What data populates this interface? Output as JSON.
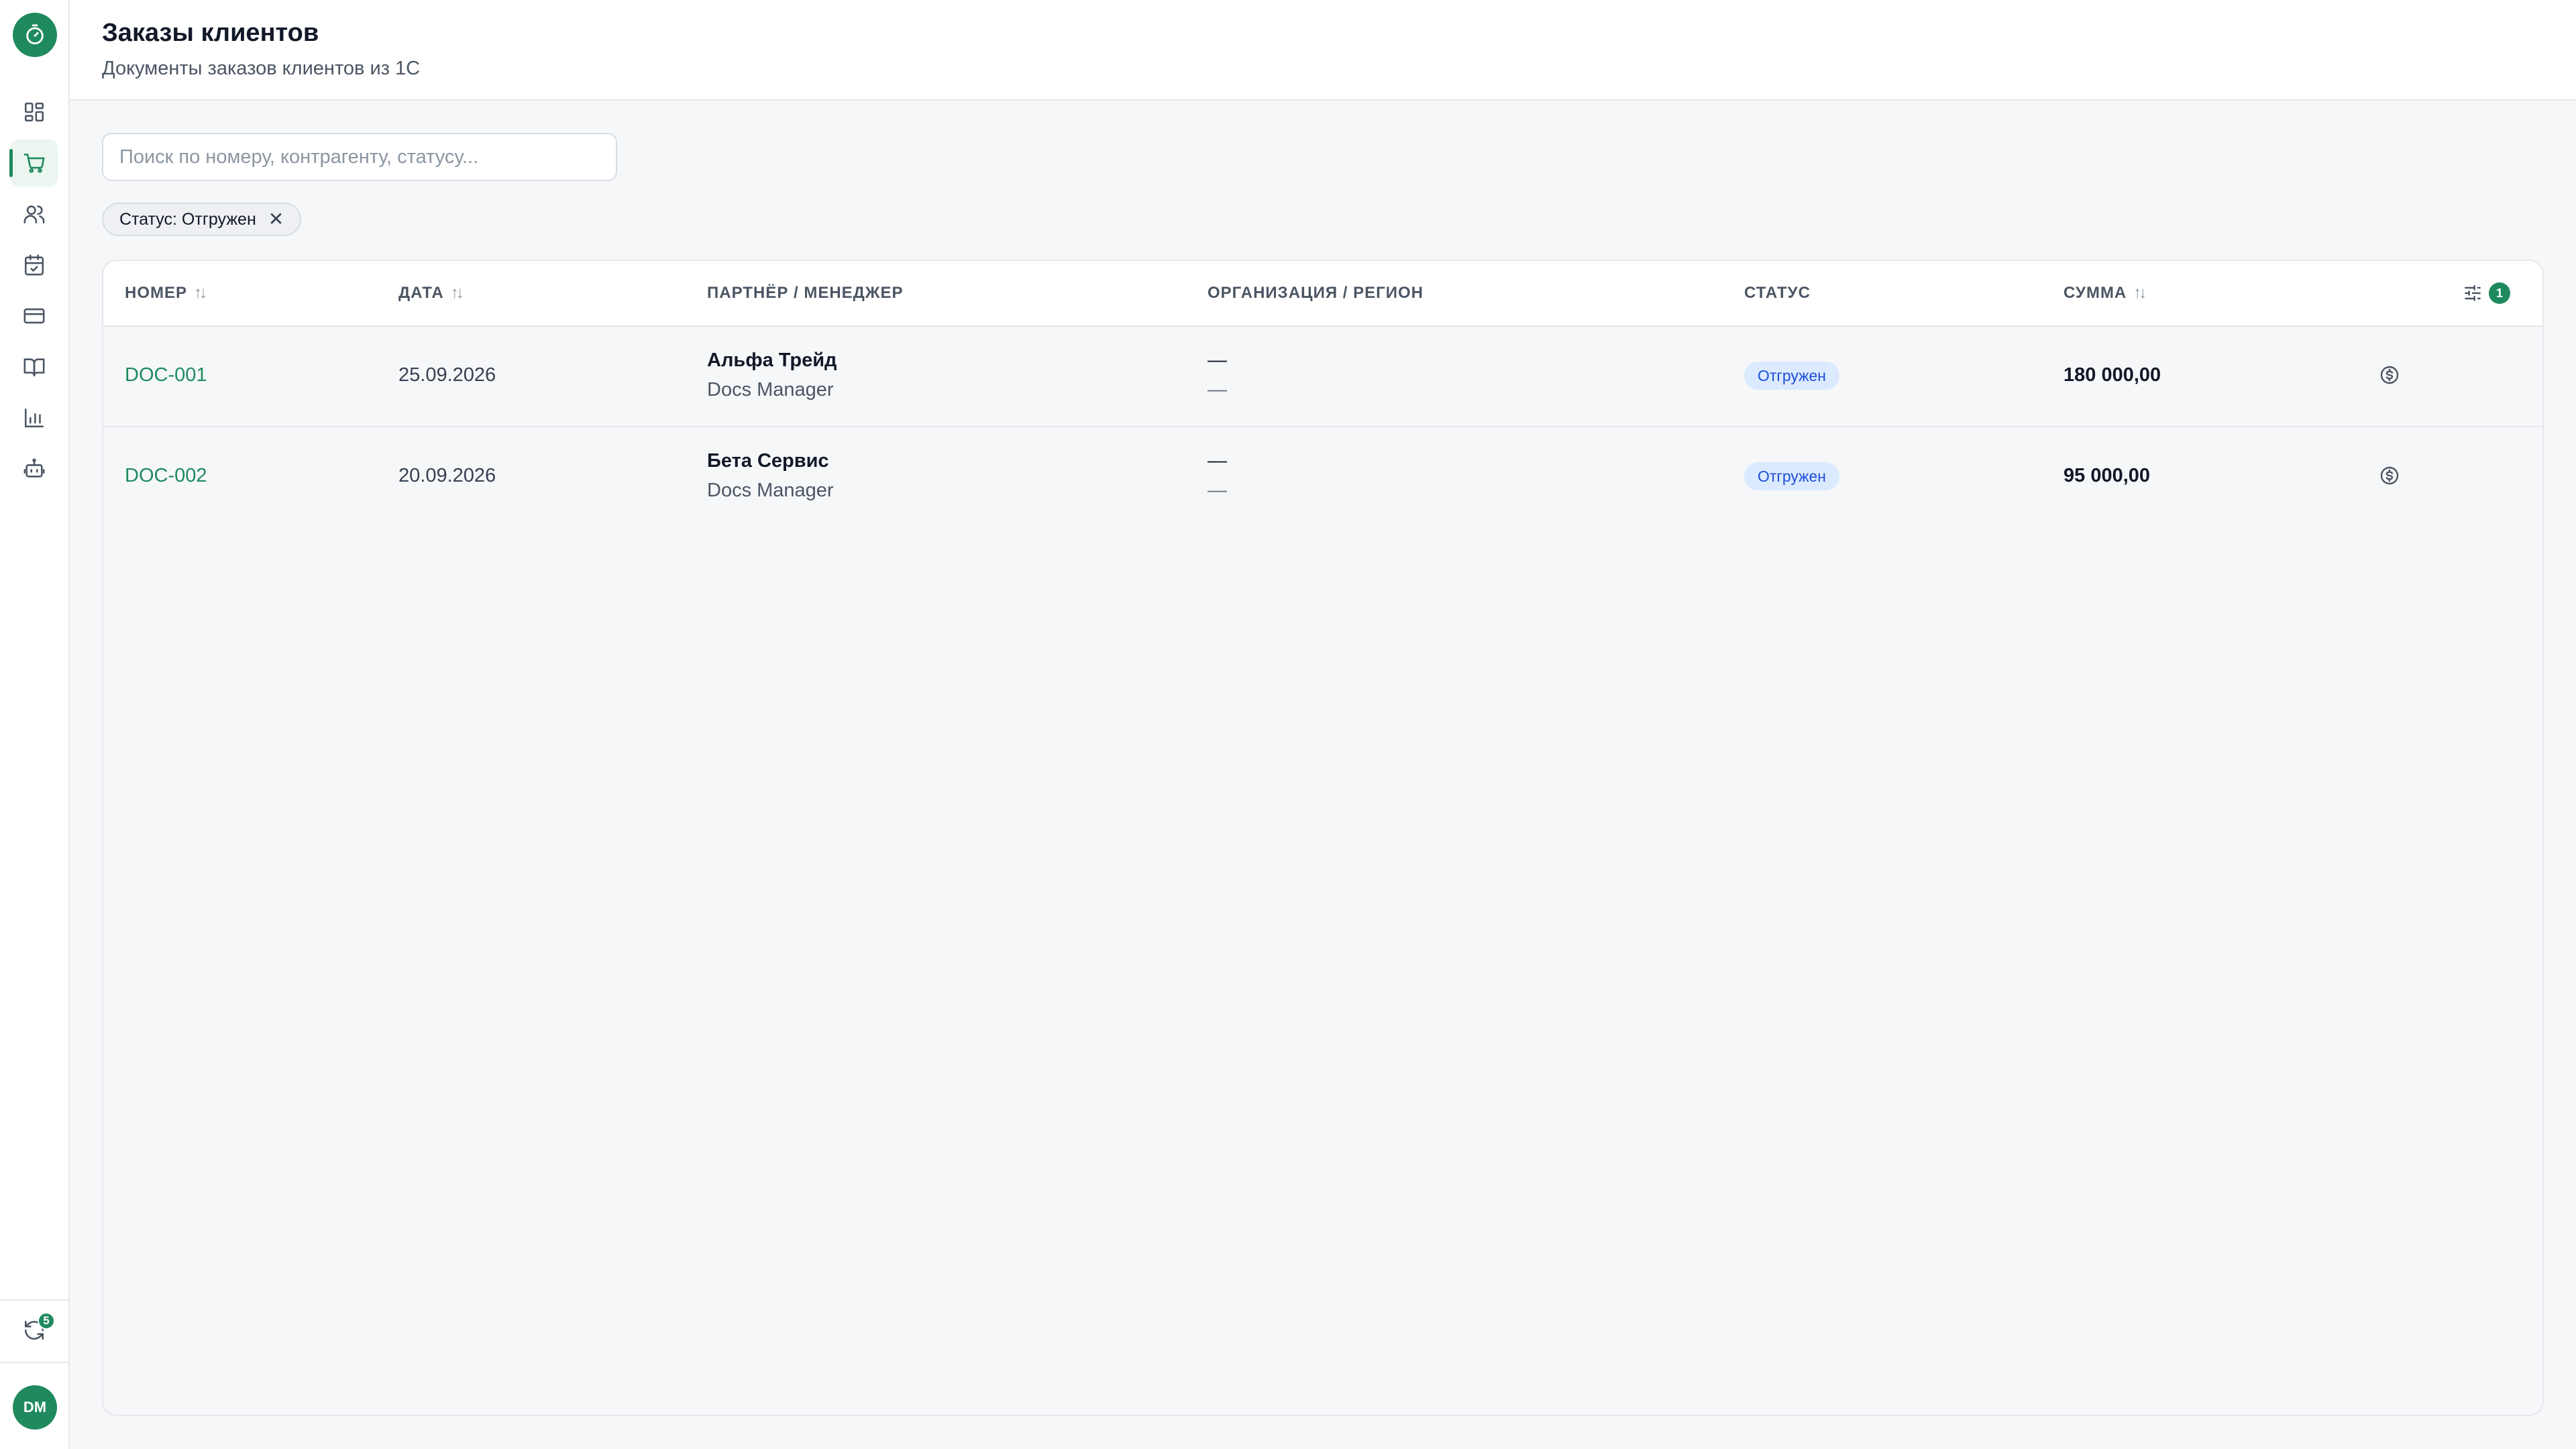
{
  "header": {
    "title": "Заказы клиентов",
    "subtitle": "Документы заказов клиентов из 1С"
  },
  "sidebar": {
    "items": [
      {
        "name": "dashboard",
        "icon": "dashboard-icon"
      },
      {
        "name": "orders",
        "icon": "cart-icon",
        "active": true
      },
      {
        "name": "clients",
        "icon": "users-icon"
      },
      {
        "name": "calendar",
        "icon": "calendar-check-icon"
      },
      {
        "name": "payments",
        "icon": "credit-card-icon"
      },
      {
        "name": "docs",
        "icon": "book-icon"
      },
      {
        "name": "reports",
        "icon": "bar-chart-icon"
      },
      {
        "name": "bot",
        "icon": "robot-icon"
      }
    ],
    "sync_count": "5",
    "user_initials": "DM"
  },
  "search": {
    "placeholder": "Поиск по номеру, контрагенту, статусу..."
  },
  "filter_chip": {
    "label": "Статус: Отгружен"
  },
  "table": {
    "columns": {
      "number": "НОМЕР",
      "date": "ДАТА",
      "partner": "ПАРТНЁР / МЕНЕДЖЕР",
      "org": "ОРГАНИЗАЦИЯ / РЕГИОН",
      "status": "СТАТУС",
      "sum": "СУММА"
    },
    "column_settings_badge": "1",
    "rows": [
      {
        "number": "DOC-001",
        "date": "25.09.2026",
        "partner": "Альфа Трейд",
        "manager": "Docs Manager",
        "org": "—",
        "region": "—",
        "status": "Отгружен",
        "sum": "180 000,00"
      },
      {
        "number": "DOC-002",
        "date": "20.09.2026",
        "partner": "Бета Сервис",
        "manager": "Docs Manager",
        "org": "—",
        "region": "—",
        "status": "Отгружен",
        "sum": "95 000,00"
      }
    ]
  },
  "colors": {
    "accent": "#1f8a5e",
    "status_bg": "#dbeafe",
    "status_text": "#1d4ed8"
  }
}
